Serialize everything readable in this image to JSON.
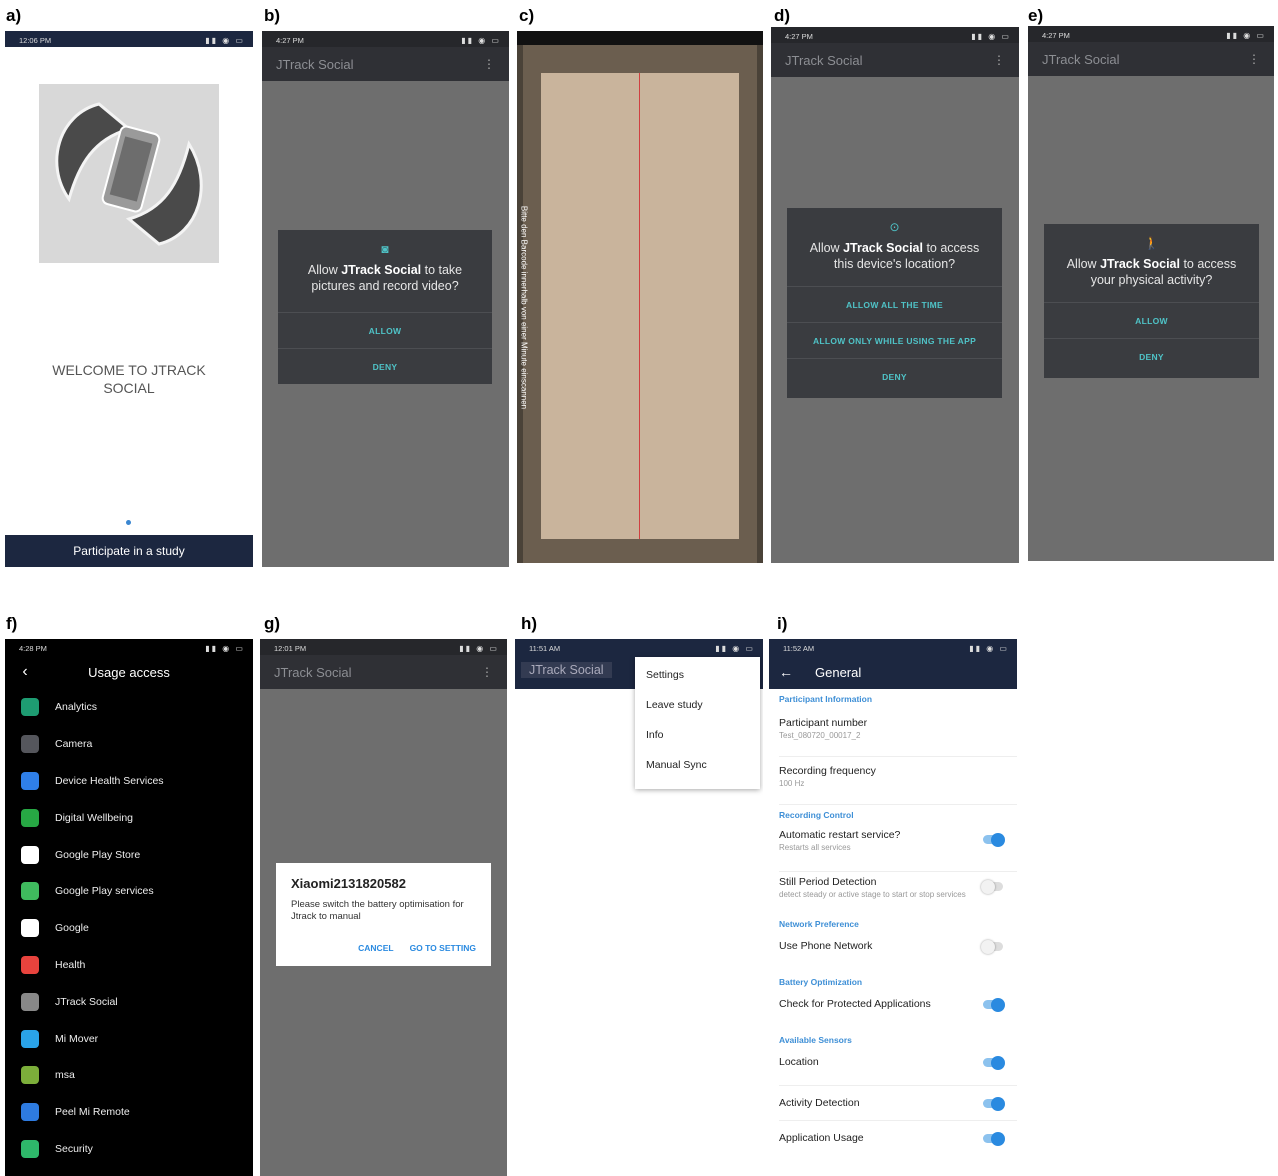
{
  "panel_labels": [
    "a)",
    "b)",
    "c)",
    "d)",
    "e)",
    "f)",
    "g)",
    "h)",
    "i)"
  ],
  "a": {
    "time": "12:06 PM",
    "welcome": "WELCOME TO   JTRACK SOCIAL",
    "participate_button": "Participate in a study"
  },
  "b": {
    "time": "4:27 PM",
    "app_title": "JTrack Social",
    "dialog_pre": "Allow ",
    "dialog_app": "JTrack Social",
    "dialog_post": " to take pictures and record video?",
    "allow": "ALLOW",
    "deny": "DENY"
  },
  "c": {
    "scan_text": "Bitte den Barcode innerhalb von einer Minute einscannen"
  },
  "d": {
    "time": "4:27 PM",
    "app_title": "JTrack Social",
    "dialog_pre": "Allow ",
    "dialog_app": "JTrack Social",
    "dialog_post": " to access this device's location?",
    "allow_all": "ALLOW ALL THE TIME",
    "allow_while": "ALLOW ONLY WHILE USING THE APP",
    "deny": "DENY"
  },
  "e": {
    "time": "4:27 PM",
    "app_title": "JTrack Social",
    "dialog_pre": "Allow ",
    "dialog_app": "JTrack Social",
    "dialog_post": " to access your physical activity?",
    "allow": "ALLOW",
    "deny": "DENY"
  },
  "f": {
    "time": "4:28 PM",
    "title": "Usage access",
    "apps": [
      {
        "name": "Analytics",
        "color": "#1e9c72",
        "icon": "android-icon"
      },
      {
        "name": "Camera",
        "color": "#55565c",
        "icon": "camera-icon"
      },
      {
        "name": "Device Health Services",
        "color": "#2f7fe8",
        "icon": "device-health-icon"
      },
      {
        "name": "Digital Wellbeing",
        "color": "#27a844",
        "icon": "wellbeing-icon"
      },
      {
        "name": "Google Play Store",
        "color": "#ffffff",
        "icon": "play-store-icon"
      },
      {
        "name": "Google Play services",
        "color": "#3fbb5e",
        "icon": "play-services-icon"
      },
      {
        "name": "Google",
        "color": "#ffffff",
        "icon": "google-icon"
      },
      {
        "name": "Health",
        "color": "#e8433d",
        "icon": "health-icon"
      },
      {
        "name": " JTrack Social",
        "color": "#888888",
        "icon": "jtrack-icon"
      },
      {
        "name": "Mi Mover",
        "color": "#2aa3e8",
        "icon": "mi-mover-icon"
      },
      {
        "name": "msa",
        "color": "#7cae3a",
        "icon": "msa-icon"
      },
      {
        "name": "Peel Mi Remote",
        "color": "#2e7be0",
        "icon": "remote-icon"
      },
      {
        "name": "Security",
        "color": "#2eb86a",
        "icon": "security-icon"
      }
    ]
  },
  "g": {
    "time": "12:01 PM",
    "app_title": "JTrack Social",
    "dialog_title": "Xiaomi2131820582",
    "dialog_text": "Please switch the battery optimisation for  Jtrack to manual",
    "cancel": "CANCEL",
    "go": "GO TO SETTING"
  },
  "h": {
    "time": "11:51 AM",
    "app_title": "JTrack Social",
    "menu": [
      "Settings",
      "Leave study",
      "Info",
      "Manual Sync"
    ]
  },
  "i": {
    "time": "11:52 AM",
    "title": "General",
    "sec1": "Participant Information",
    "pn_title": "Participant number",
    "pn_value": "Test_080720_00017_2",
    "rf_title": "Recording frequency",
    "rf_value": "100 Hz",
    "sec2": "Recording Control",
    "ars_title": "Automatic restart service?",
    "ars_sub": "Restarts all services",
    "spd_title": "Still Period Detection",
    "spd_sub": "detect steady or active stage to start or stop services",
    "sec3": "Network Preference",
    "upn_title": "Use Phone Network",
    "sec4": "Battery Optimization",
    "cpa_title": "Check for Protected Applications",
    "sec5": "Available Sensors",
    "loc": "Location",
    "act": "Activity Detection",
    "app": "Application Usage"
  }
}
